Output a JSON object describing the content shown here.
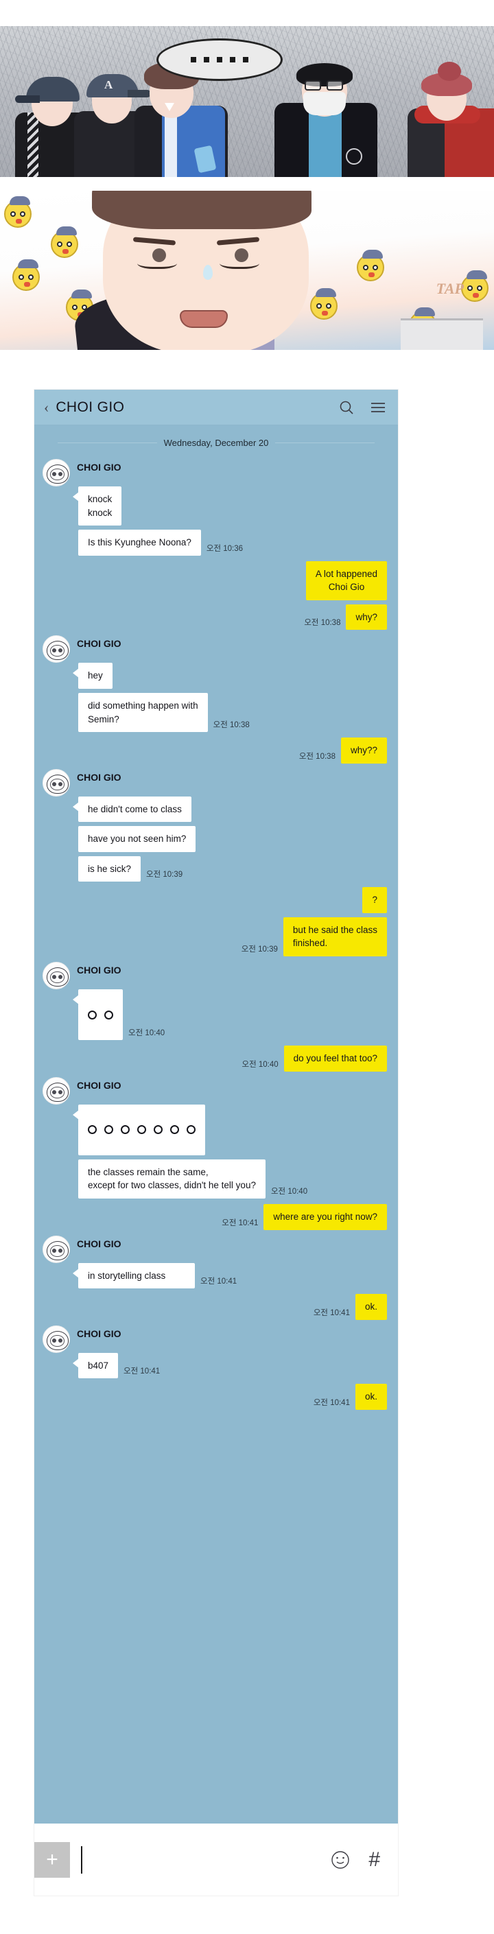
{
  "comic": {
    "panel1": {
      "speech_bubble_dots": 5,
      "bubble_text": "· · · · ·"
    },
    "panel2": {
      "sfx_text": "TAP",
      "chick_count": 9
    }
  },
  "messenger": {
    "header": {
      "back_icon": "chevron-left-icon",
      "title": "CHOI GIO",
      "search_icon": "search-icon",
      "menu_icon": "hamburger-menu-icon",
      "bg_color": "#9cc4d8"
    },
    "date_separator": "Wednesday, December 20",
    "contact_name": "CHOI GIO",
    "body_bg_color": "#8fb9cf",
    "my_bubble_color": "#f7e800",
    "their_bubble_color": "#ffffff",
    "groups": [
      {
        "side": "left",
        "sender": "CHOI GIO",
        "messages": [
          {
            "text": "knock\nknock",
            "time": ""
          },
          {
            "text": "Is this Kyunghee Noona?",
            "time": "오전 10:36"
          }
        ]
      },
      {
        "side": "right",
        "sender": "",
        "messages": [
          {
            "text": "A lot happened\nChoi Gio",
            "time": ""
          },
          {
            "text": "why?",
            "time": "오전 10:38"
          }
        ]
      },
      {
        "side": "left",
        "sender": "CHOI GIO",
        "messages": [
          {
            "text": "hey",
            "time": ""
          },
          {
            "text": "did something happen with\nSemin?",
            "time": "오전 10:38"
          }
        ]
      },
      {
        "side": "right",
        "sender": "",
        "messages": [
          {
            "text": "why??",
            "time": "오전 10:38"
          }
        ]
      },
      {
        "side": "left",
        "sender": "CHOI GIO",
        "messages": [
          {
            "text": "he didn't come to class",
            "time": ""
          },
          {
            "text": "have you not seen him?",
            "time": ""
          },
          {
            "text": "is he sick?",
            "time": "오전 10:39"
          }
        ]
      },
      {
        "side": "right",
        "sender": "",
        "messages": [
          {
            "text": "?",
            "time": ""
          },
          {
            "text": "but he said the class\nfinished.",
            "time": "오전 10:39"
          }
        ]
      },
      {
        "side": "left",
        "sender": "CHOI GIO",
        "messages": [
          {
            "text": "",
            "circles": 2,
            "time": "오전 10:40"
          }
        ]
      },
      {
        "side": "right",
        "sender": "",
        "messages": [
          {
            "text": "do you feel that too?",
            "time": "오전 10:40"
          }
        ]
      },
      {
        "side": "left",
        "sender": "CHOI GIO",
        "messages": [
          {
            "text": "",
            "circles": 7,
            "time": ""
          },
          {
            "text": "the classes remain the same,\nexcept for two classes, didn't he tell you?",
            "time": "오전 10:40"
          }
        ]
      },
      {
        "side": "right",
        "sender": "",
        "messages": [
          {
            "text": "where are you right now?",
            "time": "오전 10:41"
          }
        ]
      },
      {
        "side": "left",
        "sender": "CHOI GIO",
        "messages": [
          {
            "text": "in storytelling class",
            "time": "오전 10:41"
          }
        ]
      },
      {
        "side": "right",
        "sender": "",
        "messages": [
          {
            "text": "ok.",
            "time": "오전 10:41"
          }
        ]
      },
      {
        "side": "left",
        "sender": "CHOI GIO",
        "messages": [
          {
            "text": "b407",
            "time": "오전 10:41"
          }
        ]
      },
      {
        "side": "right",
        "sender": "",
        "messages": [
          {
            "text": "ok.",
            "time": "오전 10:41"
          }
        ]
      }
    ],
    "input_bar": {
      "plus_label": "+",
      "placeholder": "",
      "value": "",
      "emoji_icon": "smiley-face-icon",
      "hash_icon": "hash-icon",
      "hash_label": "#"
    }
  }
}
